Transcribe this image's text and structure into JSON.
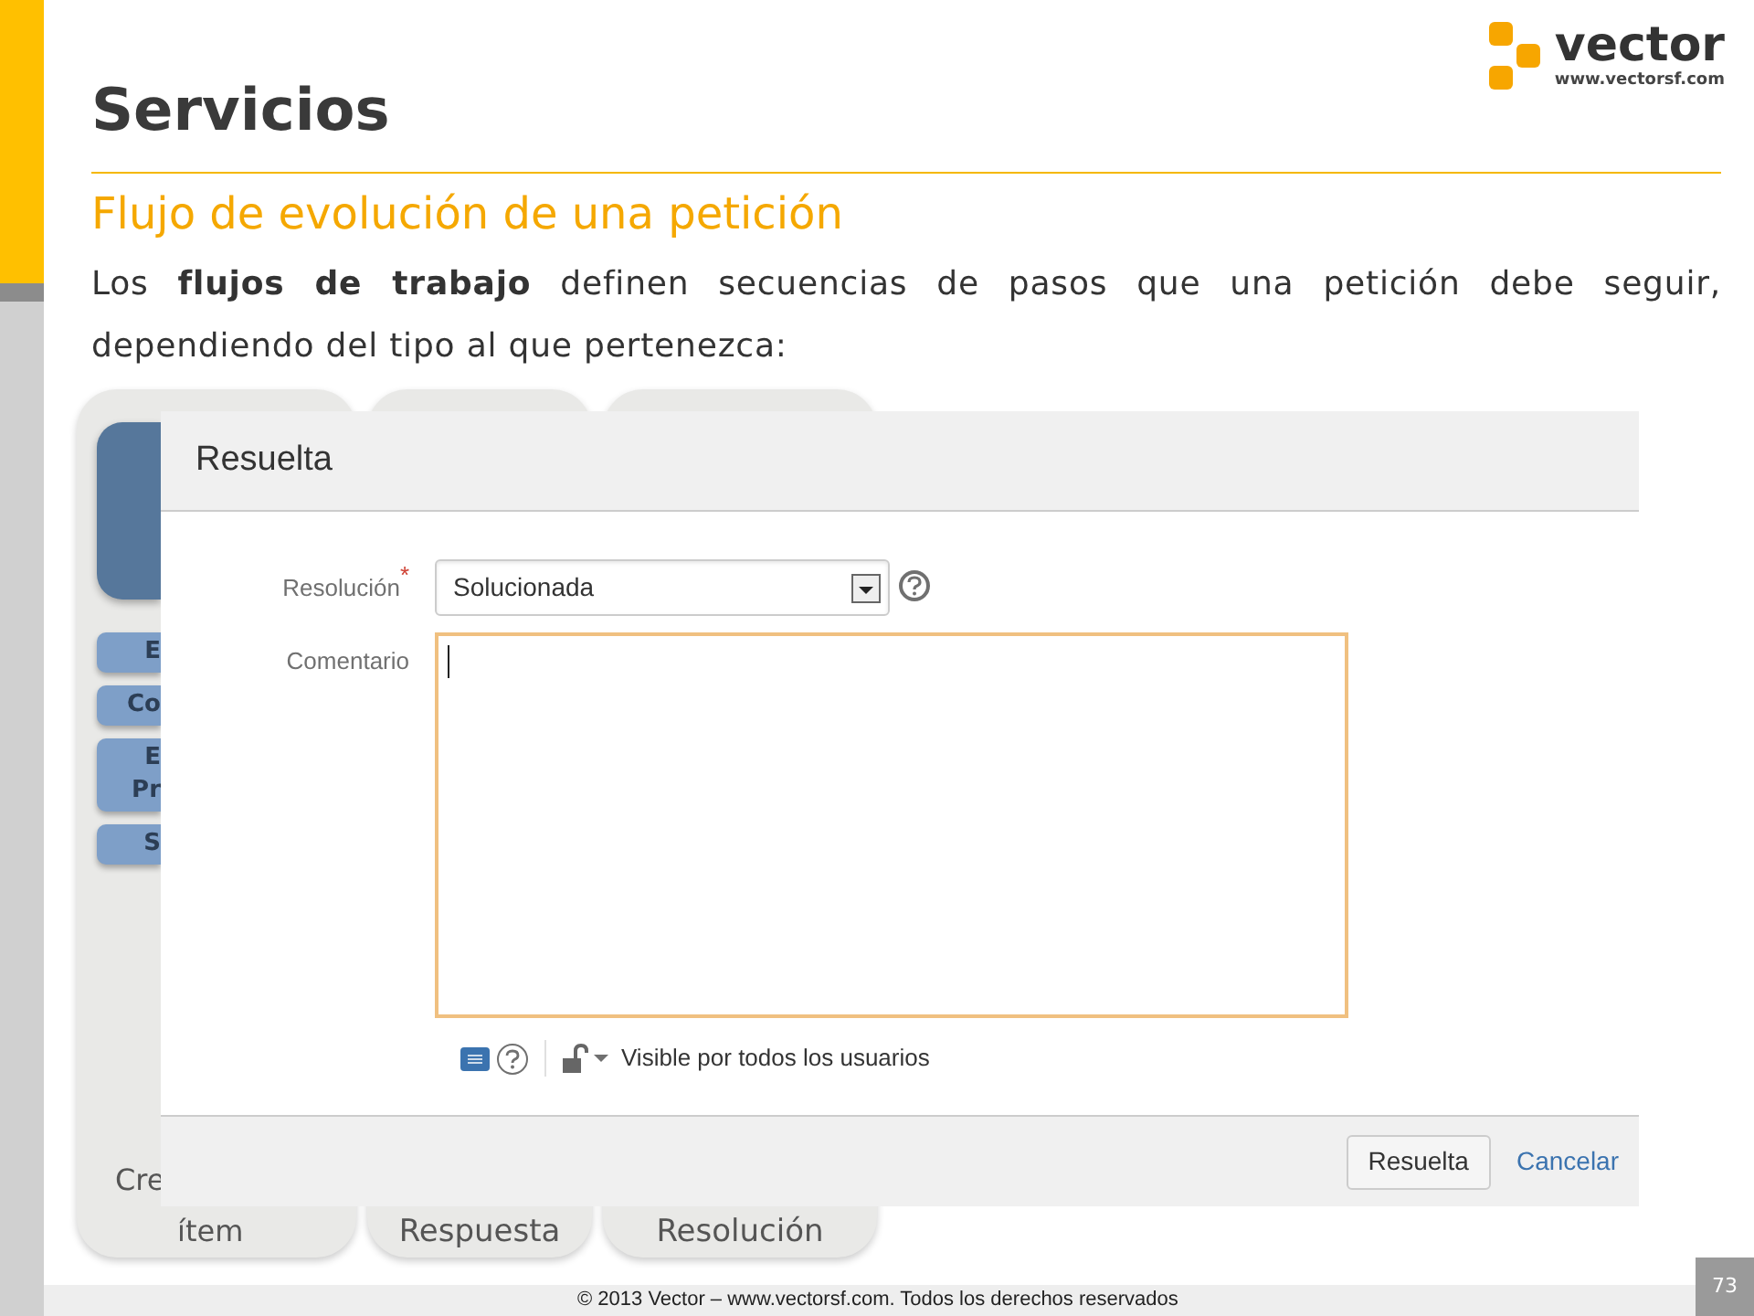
{
  "slide": {
    "title": "Servicios",
    "subtitle": "Flujo de evolución de una petición",
    "paragraph": "Los **flujos de trabajo** definen secuencias de pasos que una petición debe seguir, dependiendo del tipo al que pertenezca:",
    "logo": {
      "name": "vector",
      "url": "www.vectorsf.com"
    },
    "footer": "© 2013 Vector – www.vectorsf.com. Todos los derechos reservados",
    "page_number": "73"
  },
  "diagram": {
    "columns": [
      {
        "kind": "states",
        "buttons": [
          [
            "E"
          ],
          [
            "Co"
          ],
          [
            "E",
            "Pr"
          ],
          [
            "S"
          ]
        ],
        "label_lines": [
          "Cre",
          "ítem"
        ]
      },
      {
        "kind": "plain",
        "label_lines": [
          "Respuesta"
        ]
      },
      {
        "kind": "plain",
        "label_lines": [
          "Resolución"
        ]
      }
    ]
  },
  "dialog": {
    "title": "Resuelta",
    "fields": [
      {
        "kind": "select",
        "label": "Resolución",
        "required_mark": "*",
        "value": "Solucionada"
      },
      {
        "kind": "textarea",
        "label": "Comentario",
        "focused": true
      }
    ],
    "visibility": "Visible por todos los usuarios",
    "buttons": [
      {
        "kind": "button",
        "label": "Resuelta"
      },
      {
        "kind": "link",
        "label": "Cancelar"
      }
    ]
  }
}
